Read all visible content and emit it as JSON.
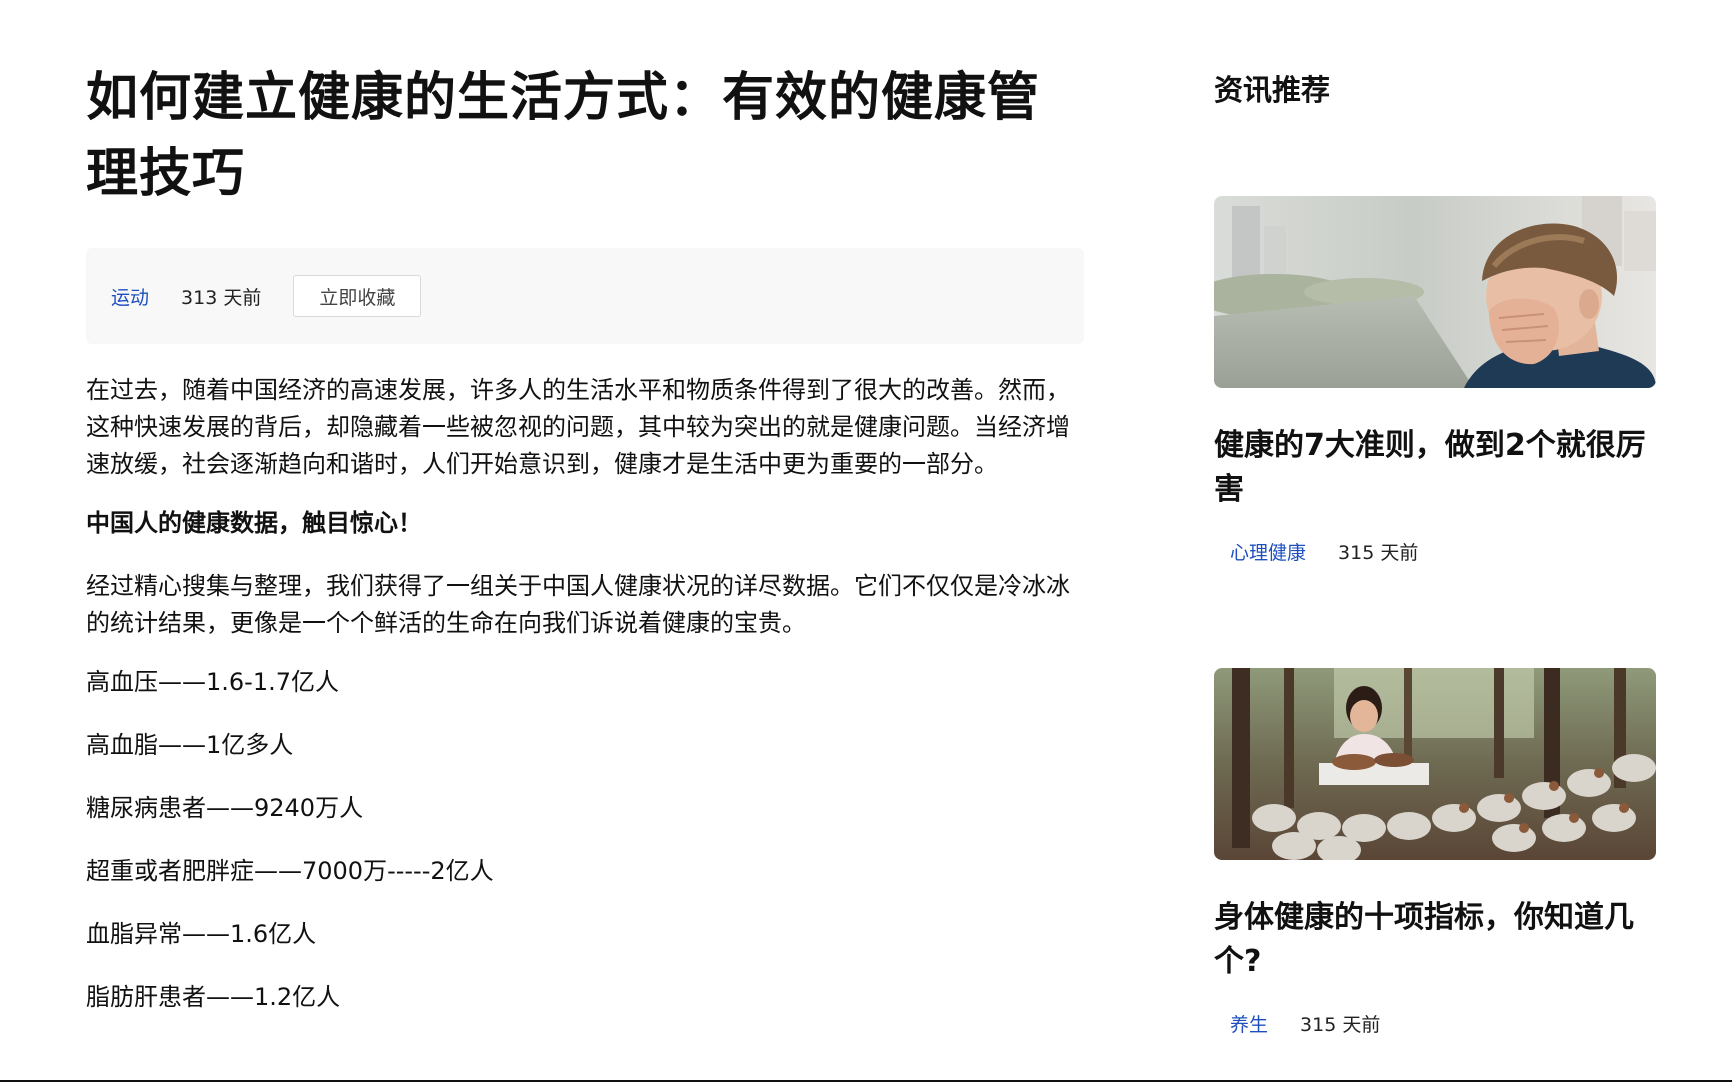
{
  "article": {
    "title": "如何建立健康的生活方式：有效的健康管理技巧",
    "category": "运动",
    "time": "313 天前",
    "favorite_label": "立即收藏",
    "paragraphs": [
      "在过去，随着中国经济的高速发展，许多人的生活水平和物质条件得到了很大的改善。然而，这种快速发展的背后，却隐藏着一些被忽视的问题，其中较为突出的就是健康问题。当经济增速放缓，社会逐渐趋向和谐时，人们开始意识到，健康才是生活中更为重要的一部分。",
      "中国人的健康数据，触目惊心！",
      "经过精心搜集与整理，我们获得了一组关于中国人健康状况的详尽数据。它们不仅仅是冷冰冰的统计结果，更像是一个个鲜活的生命在向我们诉说着健康的宝贵。"
    ],
    "stats": [
      "高血压——1.6-1.7亿人",
      "高血脂——1亿多人",
      "糖尿病患者——9240万人",
      "超重或者肥胖症——7000万-----2亿人",
      "血脂异常——1.6亿人",
      "脂肪肝患者——1.2亿人"
    ]
  },
  "sidebar": {
    "title": "资讯推荐",
    "cards": [
      {
        "title": "健康的7大准则，做到2个就很厉害",
        "tag": "心理健康",
        "time": "315 天前",
        "image": "man-covering-face-photo"
      },
      {
        "title": "身体健康的十项指标，你知道几个?",
        "tag": "养生",
        "time": "315 天前",
        "image": "woman-mushroom-farm-photo"
      }
    ]
  },
  "colors": {
    "accent": "#1f4fbf",
    "meta_bg": "#f8f8f8"
  }
}
